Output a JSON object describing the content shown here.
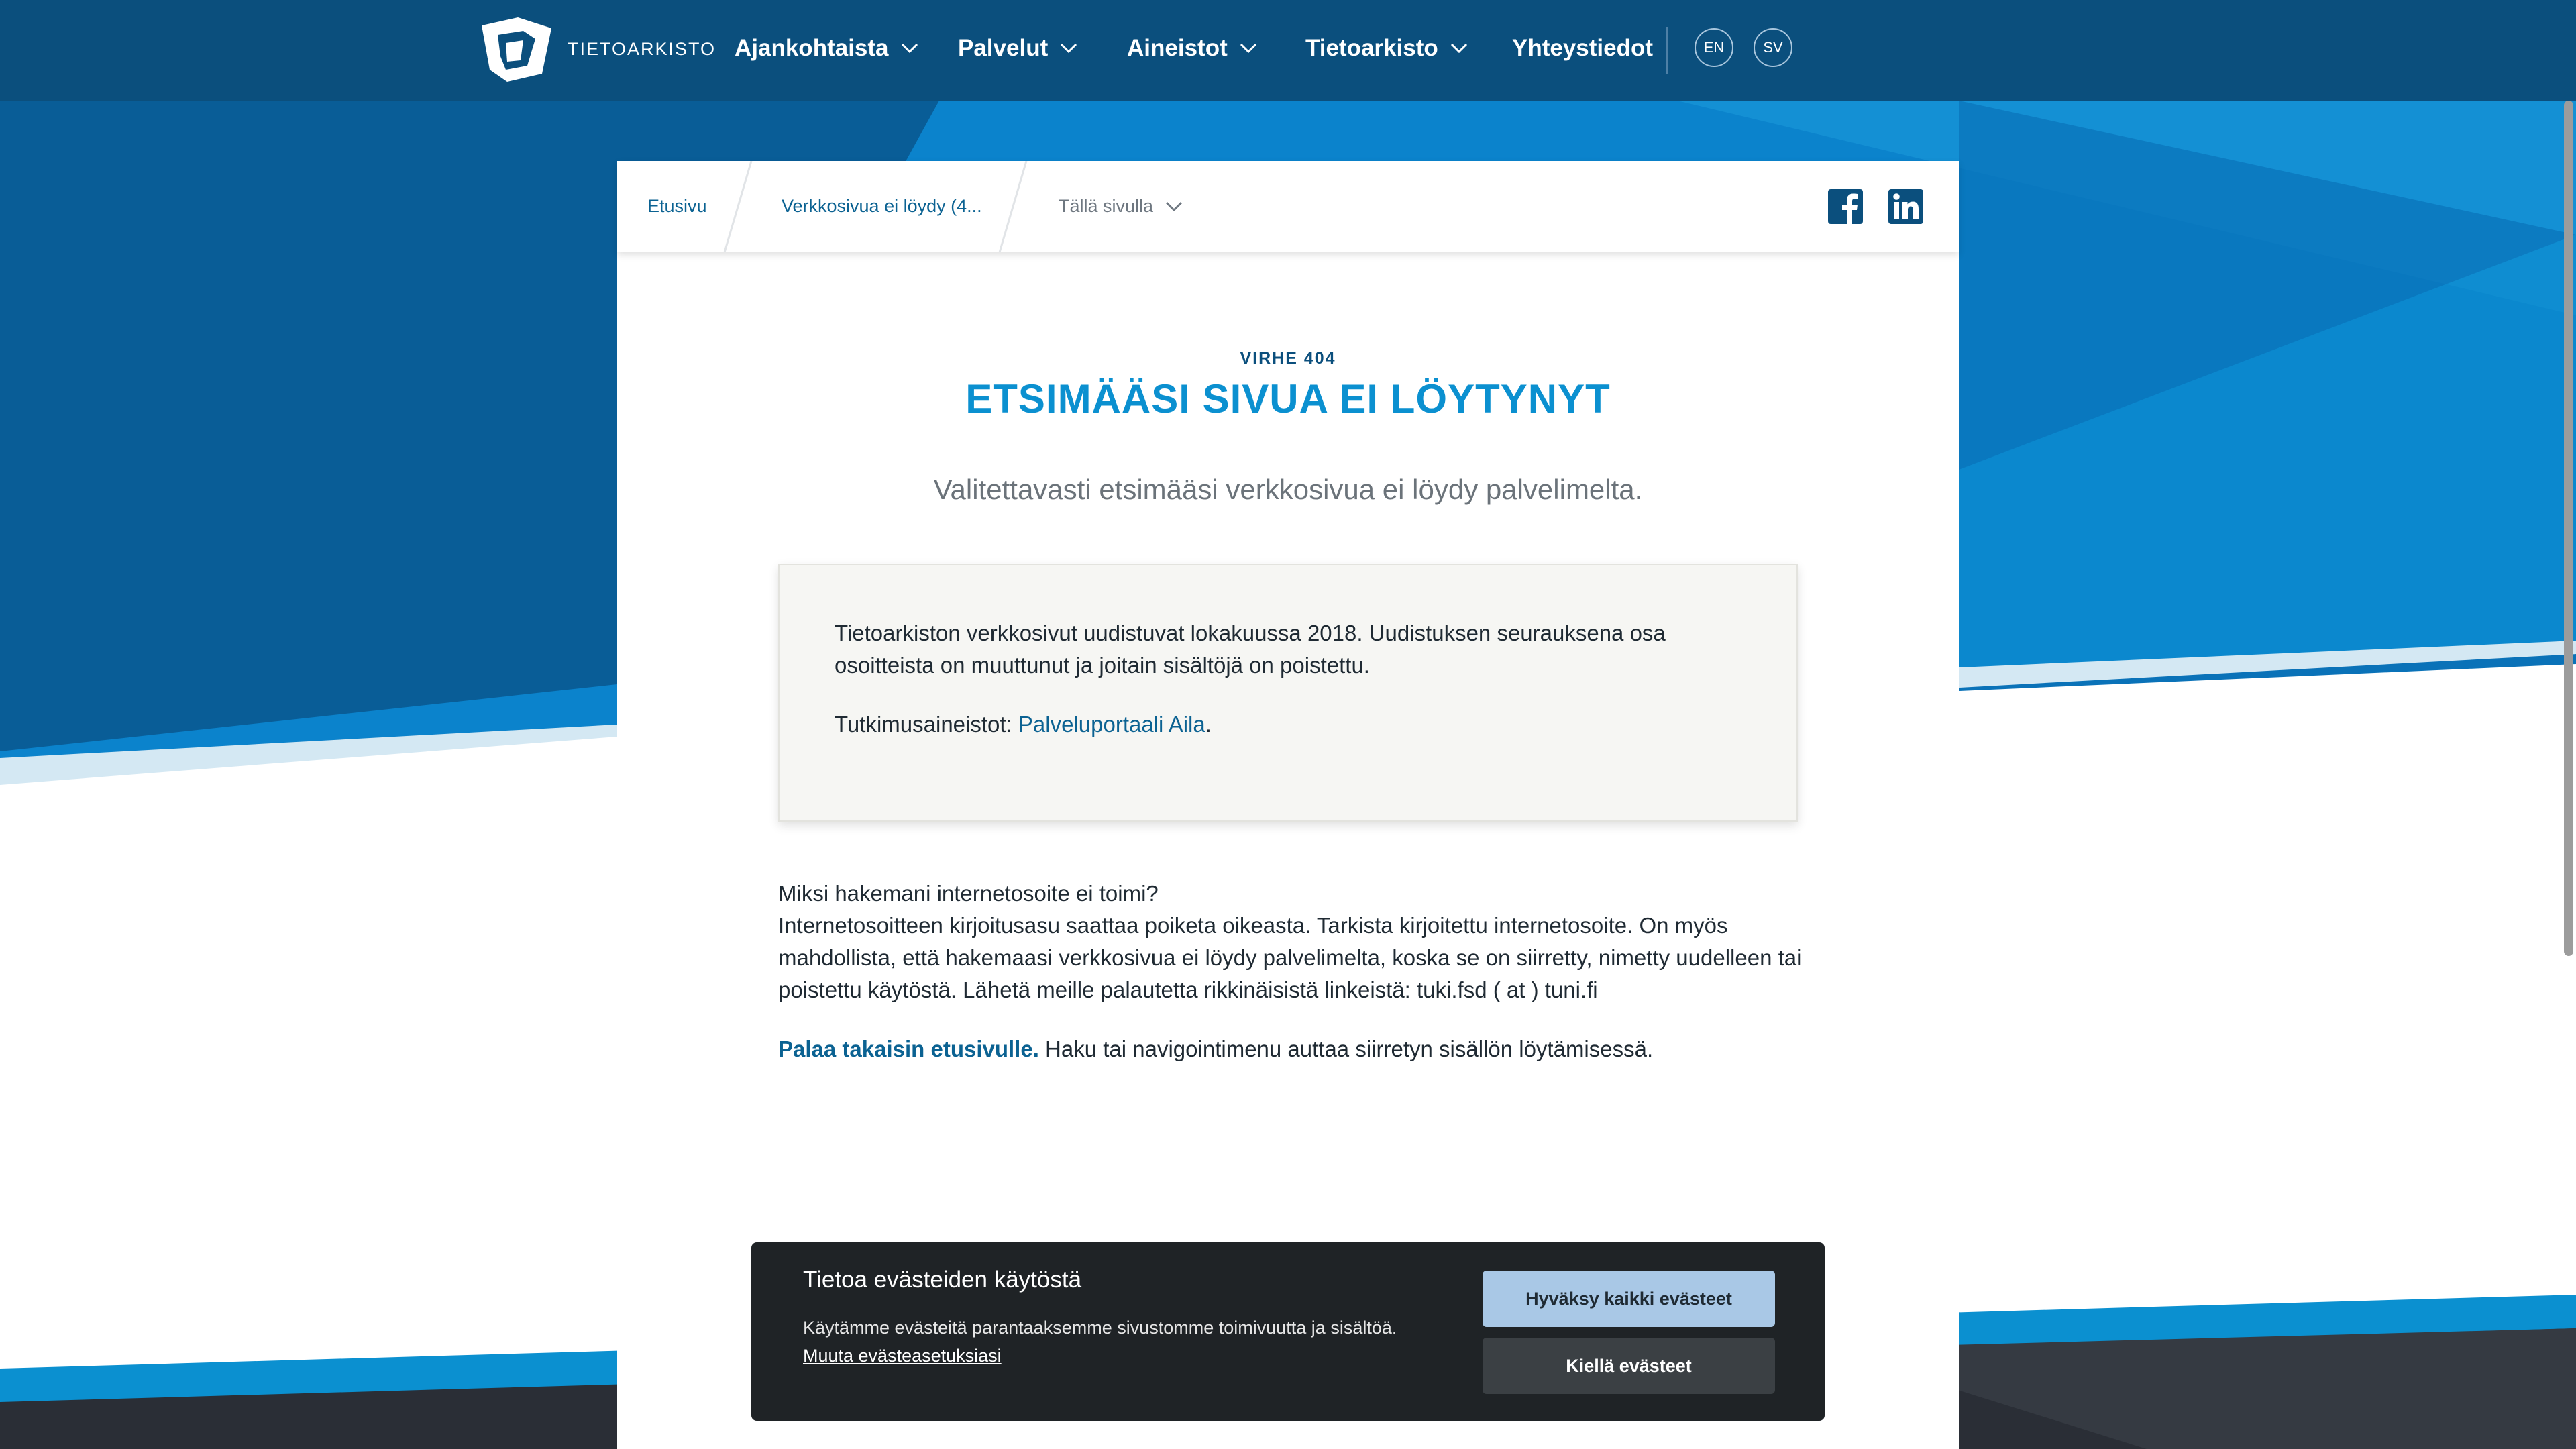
{
  "colors": {
    "nav_bg": "#0b4f7d",
    "accent_blue": "#0b90d0",
    "link_blue": "#0b6292",
    "cookie_bg": "#1f2326",
    "accept_button": "#a9c8e6"
  },
  "nav": {
    "logo_text": "TIETOARKISTO",
    "items": [
      {
        "label": "Ajankohtaista",
        "icon": "chevron-down-icon"
      },
      {
        "label": "Palvelut",
        "icon": "chevron-down-icon"
      },
      {
        "label": "Aineistot",
        "icon": "chevron-down-icon"
      },
      {
        "label": "Tietoarkisto",
        "icon": "chevron-down-icon"
      },
      {
        "label": "Yhteystiedot"
      }
    ],
    "languages": [
      "EN",
      "SV"
    ]
  },
  "breadcrumb": {
    "home": "Etusivu",
    "current": "Verkkosivua ei löydy (4...",
    "on_this_page": "Tällä sivulla",
    "social": [
      "facebook-icon",
      "linkedin-icon"
    ]
  },
  "page": {
    "eyebrow": "VIRHE 404",
    "title": "ETSIMÄÄSI SIVUA EI LÖYTYNYT",
    "lead": "Valitettavasti etsimääsi verkkosivua ei löydy palvelimelta."
  },
  "notice": {
    "text": "Tietoarkiston verkkosivut uudistuvat lokakuussa 2018. Uudistuksen seurauksena osa osoitteista on muuttunut ja joitain sisältöjä on poistettu.",
    "link_prefix": "Tutkimusaineistot: ",
    "link_label": "Palveluportaali Aila",
    "link_suffix": "."
  },
  "help": {
    "question": "Miksi hakemani internetosoite ei toimi?",
    "explanation": "Internetosoitteen kirjoitusasu saattaa poiketa oikeasta. Tarkista kirjoitettu internetosoite. On myös mahdollista, että hakemaasi verkkosivua ei löydy palvelimelta, koska se on siirretty, nimetty uudelleen tai poistettu käytöstä. Lähetä meille palautetta rikkinäisistä linkeistä: tuki.fsd ( at ) tuni.fi",
    "back_link": "Palaa takaisin etusivulle.",
    "back_suffix": " Haku tai navigointimenu auttaa siirretyn sisällön löytämisessä."
  },
  "cookie": {
    "title": "Tietoa evästeiden käytöstä",
    "text": "Käytämme evästeitä parantaaksemme sivustomme toimivuutta ja sisältöä.",
    "settings_link": "Muuta evästeasetuksiasi",
    "accept": "Hyväksy kaikki evästeet",
    "deny": "Kiellä evästeet"
  }
}
